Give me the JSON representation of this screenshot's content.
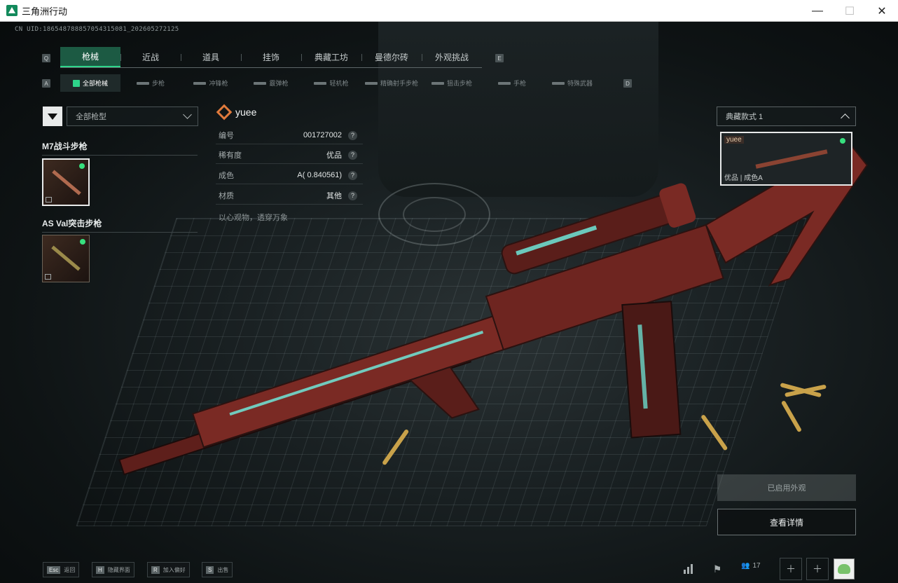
{
  "window": {
    "title": "三角洲行动",
    "minimize": "—",
    "maximize": "☐",
    "close": "✕"
  },
  "uid": "CN UID:1865487888570543150​81_202605272125",
  "main_tabs": {
    "key_left": "Q",
    "key_right": "E",
    "items": [
      "枪械",
      "近战",
      "道具",
      "挂饰",
      "典藏工坊",
      "曼德尔砖",
      "外观挑战"
    ],
    "active_index": 0
  },
  "sub_tabs": {
    "key_left": "A",
    "key_right": "D",
    "items": [
      "全部枪械",
      "步枪",
      "冲锋枪",
      "霰弹枪",
      "轻机枪",
      "精确射手步枪",
      "狙击步枪",
      "手枪",
      "特殊武器"
    ],
    "active_index": 0
  },
  "filter": {
    "weapon_type": "全部枪型"
  },
  "groups": [
    {
      "title": "M7战斗步枪",
      "selected": true
    },
    {
      "title": "AS Val突击步枪",
      "selected": false
    }
  ],
  "skin": {
    "name": "yuee",
    "rows": [
      {
        "label": "编号",
        "value": "001727002"
      },
      {
        "label": "稀有度",
        "value": "优品"
      },
      {
        "label": "成色",
        "value": "A( 0.840561)"
      },
      {
        "label": "材质",
        "value": "其他"
      }
    ],
    "help": "?",
    "slogan": "以心观物，透穿万象"
  },
  "style_panel": {
    "select": "典藏款式 1",
    "card_tag": "yuee",
    "card_caption": "优品 | 成色A"
  },
  "buttons": {
    "applied": "已启用外观",
    "detail": "查看详情"
  },
  "bottom_hints": [
    {
      "key": "Esc",
      "label": "返回"
    },
    {
      "key": "H",
      "label": "隐藏界面"
    },
    {
      "key": "R",
      "label": "加入偏好"
    },
    {
      "key": "S",
      "label": "出售"
    }
  ],
  "friends_count": "17",
  "colors": {
    "accent": "#2ed48a",
    "tab_active_bg": "#1c5a43",
    "gun_body": "#7a2a24",
    "neon": "#6ff3e4"
  }
}
